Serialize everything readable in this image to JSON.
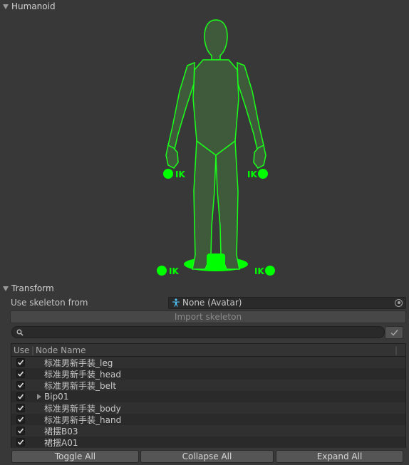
{
  "humanoid_section": {
    "title": "Humanoid",
    "ik_labels": [
      "IK",
      "IK",
      "IK",
      "IK"
    ]
  },
  "transform_section": {
    "title": "Transform",
    "skeleton_label": "Use skeleton from",
    "skeleton_value": "None (Avatar)",
    "import_button": "Import skeleton",
    "search_placeholder": "",
    "apply_icon": "checkmark-icon"
  },
  "tree": {
    "col_use": "Use",
    "col_name": "Node Name",
    "rows": [
      {
        "name": "标准男新手装_leg",
        "checked": true
      },
      {
        "name": "标准男新手装_head",
        "checked": true
      },
      {
        "name": "标准男新手装_belt",
        "checked": true
      },
      {
        "name": "Bip01",
        "checked": true,
        "expandable": true
      },
      {
        "name": "标准男新手装_body",
        "checked": true
      },
      {
        "name": "标准男新手装_hand",
        "checked": true
      },
      {
        "name": "裙摆B03",
        "checked": true
      },
      {
        "name": "裙摆A01",
        "checked": true
      }
    ]
  },
  "buttons": {
    "toggle_all": "Toggle All",
    "collapse_all": "Collapse All",
    "expand_all": "Expand All"
  },
  "colors": {
    "figure_fill": "#3f5a3a",
    "figure_stroke": "#1aff1a",
    "ik_green": "#00ff00",
    "background": "#383838"
  }
}
